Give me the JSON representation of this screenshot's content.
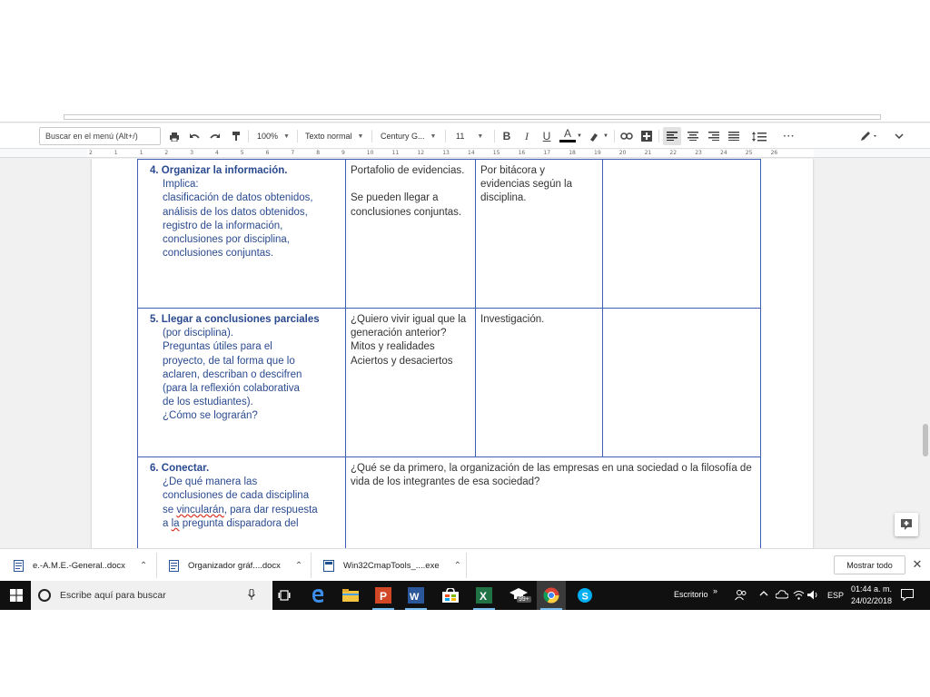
{
  "toolbar": {
    "search_placeholder": "Buscar en el menú (Alt+/)",
    "zoom": "100%",
    "style": "Texto normal",
    "font": "Century G...",
    "font_size": "11",
    "bold": "B",
    "italic": "I",
    "underline": "U",
    "text_color": "A",
    "more": "···"
  },
  "ruler": {
    "marks": [
      "2",
      "1",
      "1",
      "2",
      "3",
      "4",
      "5",
      "6",
      "7",
      "8",
      "9",
      "10",
      "11",
      "12",
      "13",
      "14",
      "15",
      "16",
      "17",
      "18",
      "19",
      "20",
      "21",
      "22",
      "23",
      "24",
      "25",
      "26"
    ]
  },
  "table": {
    "row4": {
      "title": "4. Organizar la información.",
      "lines": "Implica:\nclasificación de datos obtenidos,\nanálisis de los datos obtenidos,\nregistro de la información,\nconclusiones por disciplina,\nconclusiones conjuntas.",
      "col2": "Portafolio de evidencias.\n\nSe pueden llegar a\nconclusiones conjuntas.",
      "col3": "Por bitácora y\nevidencias según la\ndisciplina."
    },
    "row5": {
      "title": "5.  Llegar a conclusiones parciales",
      "lines": "(por disciplina).\nPreguntas útiles para el\nproyecto, de tal forma que lo\naclaren, describan o descifren\n(para la  reflexión colaborativa\nde los estudiantes).\n¿Cómo se lograrán?",
      "col2": "¿Quiero vivir igual que la\ngeneración anterior?\nMitos y realidades\nAciertos y desaciertos",
      "col3": "Investigación."
    },
    "row6": {
      "title": "6. Conectar.",
      "line1": "¿De qué manera  las",
      "line2": "conclusiones de cada disciplina",
      "line3_pre": "se ",
      "line3_word": "vincularán",
      "line3_post": ", para dar respuesta",
      "line4_pre": "a ",
      "line4_word": "la",
      "line4_post": " pregunta disparadora del",
      "span_text": "¿Qué se da primero, la organización de las empresas en una sociedad o la filosofía de vida de los integrantes de esa sociedad?"
    }
  },
  "downloads": {
    "items": [
      {
        "name": "e.-A.M.E.-General..docx",
        "icon": "word-doc-icon"
      },
      {
        "name": "Organizador gráf....docx",
        "icon": "word-doc-icon"
      },
      {
        "name": "Win32CmapTools_....exe",
        "icon": "installer-icon"
      }
    ],
    "show_all": "Mostrar todo"
  },
  "taskbar": {
    "search_placeholder": "Escribe aquí para buscar",
    "desktop_label": "Escritorio",
    "chrome_badge": "99+",
    "language": "ESP",
    "time": "01:44 a. m.",
    "date": "24/02/2018"
  },
  "colors": {
    "table_border": "#3e5fb4",
    "text_blue": "#2a4a8f",
    "taskbar": "#101010",
    "taskbar_accent": "#76b9ed"
  }
}
